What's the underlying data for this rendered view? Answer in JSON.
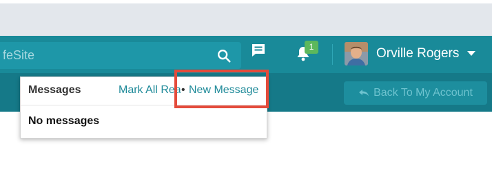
{
  "search": {
    "placeholder": "feSite"
  },
  "notifications": {
    "badge_count": "1"
  },
  "user": {
    "name": "Orville Rogers"
  },
  "subbar": {
    "back_label": "Back To My Account"
  },
  "messages_dropdown": {
    "title": "Messages",
    "mark_all_read": "Mark All Read",
    "separator": "•",
    "new_message": "New Message",
    "empty_text": "No messages"
  },
  "colors": {
    "navbar": "#198a99",
    "subbar": "#157988",
    "link": "#1f8a99",
    "badge": "#5cb85c",
    "highlight": "#e44b3b"
  },
  "icons": [
    "search-icon",
    "message-icon",
    "bell-icon",
    "caret-down-icon",
    "undo-icon"
  ]
}
